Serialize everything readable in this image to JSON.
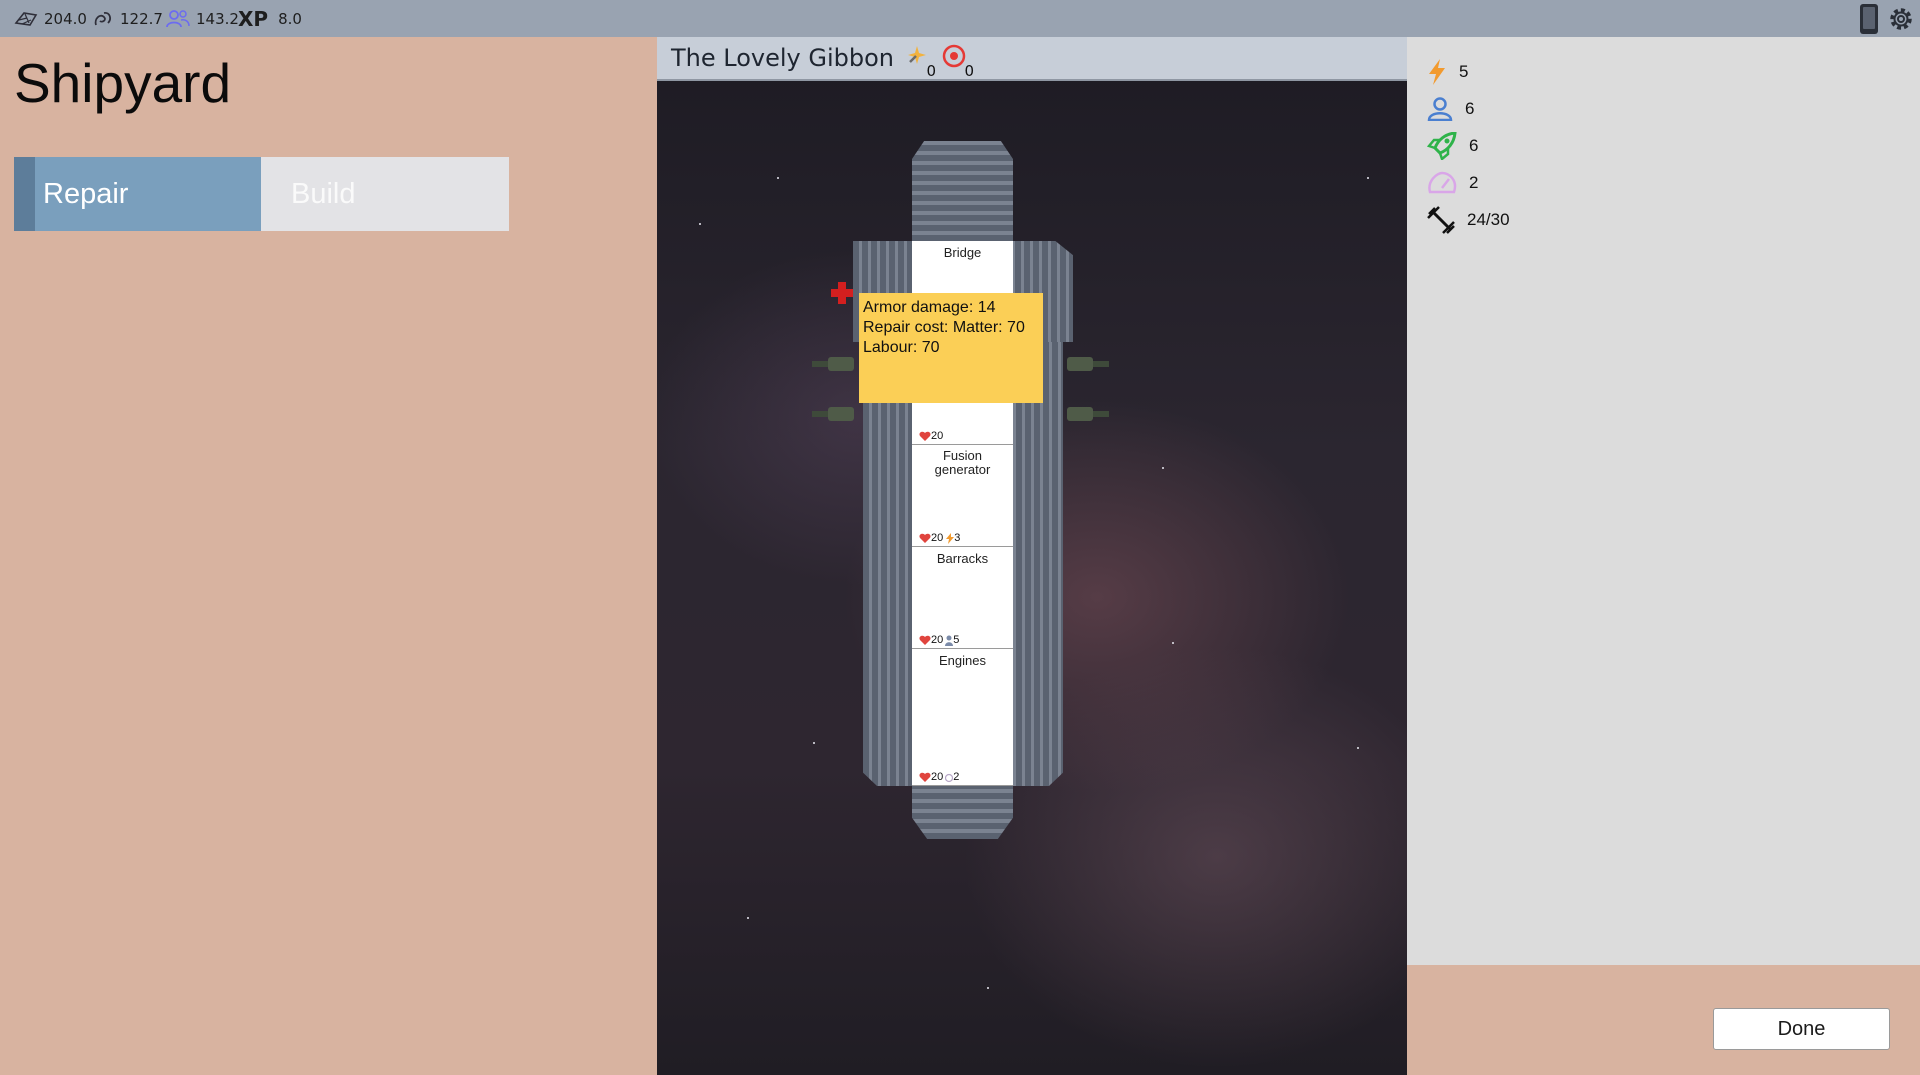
{
  "top_bar": {
    "resources": [
      {
        "icon": "matter-icon",
        "value": "204.0"
      },
      {
        "icon": "energy-swirl-icon",
        "value": "122.7"
      },
      {
        "icon": "crew-icon",
        "value": "143.2"
      }
    ],
    "xp_label": "XP",
    "xp_value": "8.0"
  },
  "left_panel": {
    "title": "Shipyard",
    "tabs": [
      {
        "label": "Repair",
        "active": true
      },
      {
        "label": "Build",
        "active": false
      }
    ]
  },
  "ship": {
    "name": "The Lovely Gibbon",
    "header_counters": [
      {
        "icon": "sparkle-wrench-icon",
        "value": "0"
      },
      {
        "icon": "target-icon",
        "value": "0"
      }
    ],
    "rooms": [
      {
        "label": "Bridge",
        "hp": "20",
        "extra": ""
      },
      {
        "label_line1": "Fusion",
        "label_line2": "generator",
        "hp": "20",
        "extra": "3"
      },
      {
        "label": "Barracks",
        "hp": "20",
        "extra": "5"
      },
      {
        "label": "Engines",
        "hp": "20",
        "extra": "2"
      }
    ],
    "tooltip": {
      "line1": "Armor damage: 14",
      "line2": "Repair cost: Matter: 70",
      "line3": "Labour: 70"
    }
  },
  "stats": [
    {
      "icon": "lightning-icon",
      "value": "5",
      "color": "#f29a2e"
    },
    {
      "icon": "person-icon",
      "value": "6",
      "color": "#4a7fd0"
    },
    {
      "icon": "rocket-icon",
      "value": "6",
      "color": "#2fb34a"
    },
    {
      "icon": "speedometer-icon",
      "value": "2",
      "color": "#d9a6e8"
    },
    {
      "icon": "strength-icon",
      "value": "24/30",
      "color": "#111111"
    }
  ],
  "done_label": "Done"
}
